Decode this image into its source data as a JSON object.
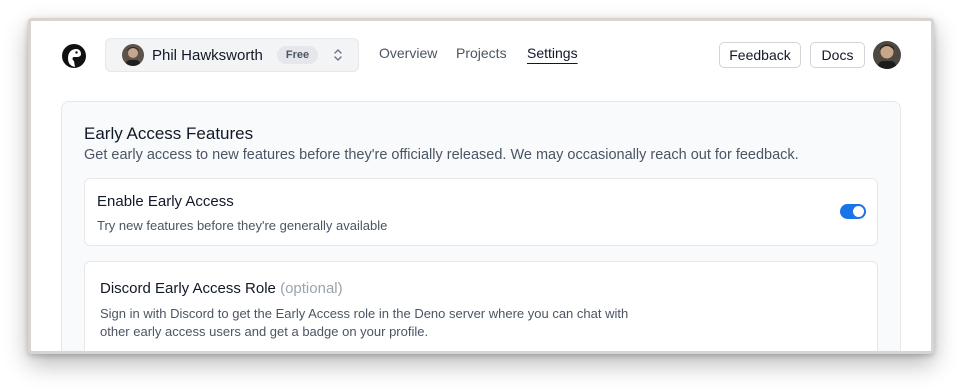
{
  "header": {
    "account_name": "Phil Hawksworth",
    "plan": "Free",
    "nav": [
      {
        "label": "Overview",
        "active": false
      },
      {
        "label": "Projects",
        "active": false
      },
      {
        "label": "Settings",
        "active": true
      }
    ],
    "feedback_label": "Feedback",
    "docs_label": "Docs"
  },
  "section": {
    "title": "Early Access Features",
    "subtitle": "Get early access to new features before they're officially released. We may occasionally reach out for feedback."
  },
  "early_access": {
    "title": "Enable Early Access",
    "description": "Try new features before they're generally available",
    "enabled": true
  },
  "discord": {
    "title": "Discord Early Access Role",
    "optional": "(optional)",
    "description": "Sign in with Discord to get the Early Access role in the Deno server where you can chat with other early access users and get a badge on your profile."
  },
  "colors": {
    "accent": "#1a73e8",
    "text": "#111827",
    "muted": "#4b5563"
  },
  "icons": [
    "deno-logo-icon",
    "avatar",
    "chevron-up-down-icon"
  ]
}
